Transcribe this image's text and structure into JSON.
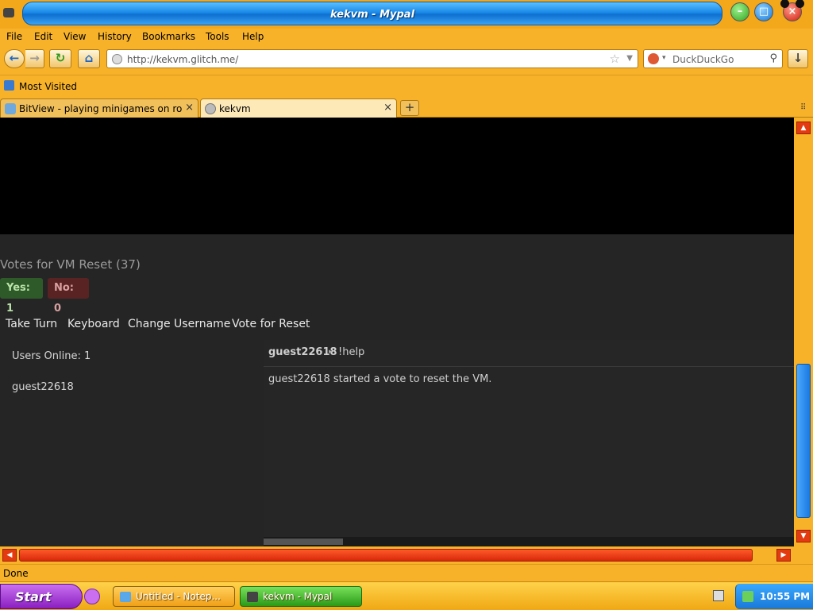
{
  "window": {
    "title": "kekvm - Mypal",
    "minimize_glyph": "–",
    "maximize_glyph": "□",
    "close_glyph": "×"
  },
  "menu": {
    "file": "File",
    "edit": "Edit",
    "view": "View",
    "history": "History",
    "bookmarks": "Bookmarks",
    "tools": "Tools",
    "help": "Help"
  },
  "nav": {
    "back_glyph": "←",
    "forward_glyph": "→",
    "reload_glyph": "↻",
    "home_glyph": "⌂",
    "url": "http://kekvm.glitch.me/",
    "bookmark_star": "☆",
    "url_dropdown": "▼",
    "search_engine_dropdown": "▾",
    "search_placeholder": "DuckDuckGo",
    "search_icon": "⚲",
    "download_glyph": "↓"
  },
  "bookmarks_bar": {
    "most_visited": "Most Visited"
  },
  "tabs": [
    {
      "label": "BitView - playing minigames on ro...",
      "close": "×"
    },
    {
      "label": "kekvm",
      "close": "×"
    }
  ],
  "new_tab_glyph": "+",
  "tabs_list_glyph": "⠿",
  "page": {
    "vote_title": "Votes for VM Reset (37)",
    "yes_label": "Yes: 1",
    "no_label": "No: 0",
    "actions": {
      "take_turn": "Take Turn",
      "keyboard": "Keyboard",
      "change_username": "Change Username",
      "vote_reset": "Vote for Reset"
    },
    "users_online": "Users Online: 1",
    "users": [
      "guest22618"
    ],
    "chat": [
      {
        "user": "guest22618",
        "separator": "▸",
        "message": "!help"
      },
      {
        "system": "guest22618 started a vote to reset the VM."
      }
    ]
  },
  "scrollbars": {
    "up": "▲",
    "down": "▼",
    "left": "◀",
    "right": "▶"
  },
  "status": "Done",
  "taskbar": {
    "start": "Start",
    "tasks": [
      {
        "label": "Untitled - Notep..."
      },
      {
        "label": "kekvm - Mypal"
      }
    ],
    "clock": "10:55 PM"
  }
}
